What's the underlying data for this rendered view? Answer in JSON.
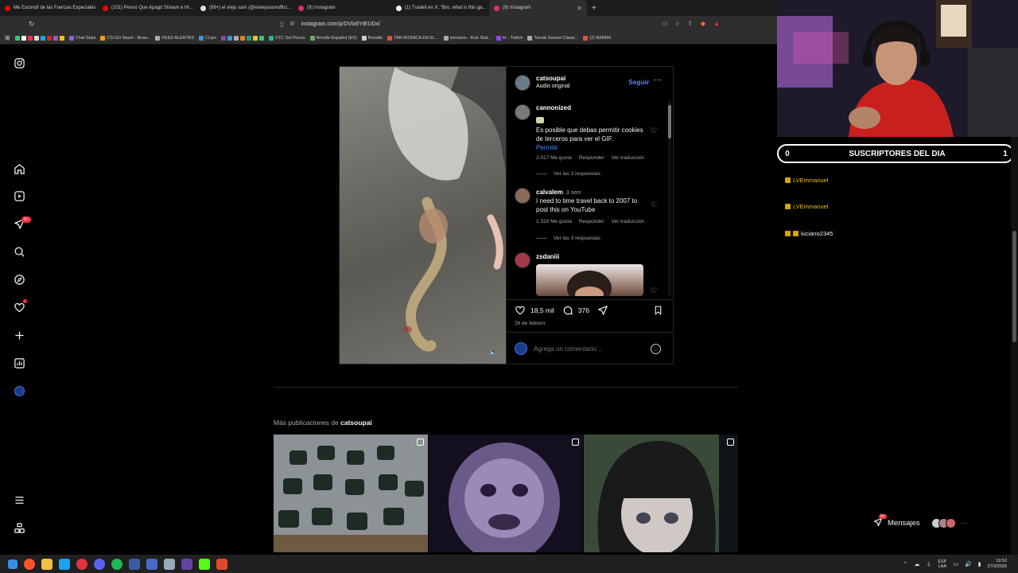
{
  "browser": {
    "tabs": [
      {
        "label": "Me Escondí de las Fuerzas Especiales",
        "color": "#ff0000"
      },
      {
        "label": "(101) Pensó Que Apagó Stream e Hi...",
        "color": "#ff0000"
      },
      {
        "label": "(99+) el viejo sam (@elviejosamoffici...",
        "color": "#e0e0e0"
      },
      {
        "label": "(9) Instagram",
        "color": "#e1306c"
      },
      {
        "label": "(1) Tradeit en X: \"Bro, what is this ga...",
        "color": "#ffffff"
      },
      {
        "label": "(9) Instagram",
        "color": "#e1306c",
        "active": true
      }
    ],
    "new_tab": "+",
    "url": "instagram.com/p/DVlx6YtEUDx/",
    "bookmarks": [
      "Chat Stats",
      "CS:GO Stash - Brow...",
      "FEED ALERTAS",
      "CLips",
      "STC Set Prices",
      "Wordle Español (ES)",
      "Boludle",
      "TAN BIONICA EN EL...",
      "sionaron - Kick Stat...",
      "trr - Twitch",
      "Tanuki Sunset Classi...",
      "(2) BARRA"
    ]
  },
  "sidebar": {
    "badge_notifications": "9+"
  },
  "post": {
    "author": "catsoupai",
    "audio": "Audio original",
    "follow_label": "Seguir",
    "more_label": "···",
    "comments": [
      {
        "user": "cannonized",
        "time": "",
        "text": "Es posible que debas permitir cookies de terceros para ver el GIF.",
        "link": "Permitir",
        "likes": "2.017 Me gusta",
        "reply": "Responder",
        "translate": "Ver traducción",
        "view_replies": "Ver las 3 respuestas"
      },
      {
        "user": "calvalem",
        "time": "3 sem",
        "text": "I need to time travel back to 2007 to post this on YouTube",
        "likes": "1.316 Me gusta",
        "reply": "Responder",
        "translate": "Ver traducción",
        "view_replies": "Ver las 3 respuestas"
      },
      {
        "user": "zsdaniii",
        "time": ""
      }
    ],
    "likes_count": "18,5 mil",
    "comments_count": "376",
    "date": "26 de febrero",
    "comment_placeholder": "Agrega un comentario..."
  },
  "more_posts": {
    "prefix": "Más publicaciones de ",
    "author": "catsoupai"
  },
  "overlay": {
    "subs_left": "0",
    "subs_title": "SUSCRIPTORES DEL DIA",
    "subs_right": "1",
    "subscribers": [
      "LVEmmanuel",
      "LVEmmanuel",
      "luciano2345"
    ],
    "messages_badge": "9+",
    "messages_label": "Mensajes"
  },
  "taskbar": {
    "lang1": "ESP",
    "lang2": "LAA",
    "time": "19:52",
    "date": "27/3/2026"
  },
  "colors": {
    "accent_blue": "#4a8cff",
    "badge_red": "#ff3040"
  }
}
